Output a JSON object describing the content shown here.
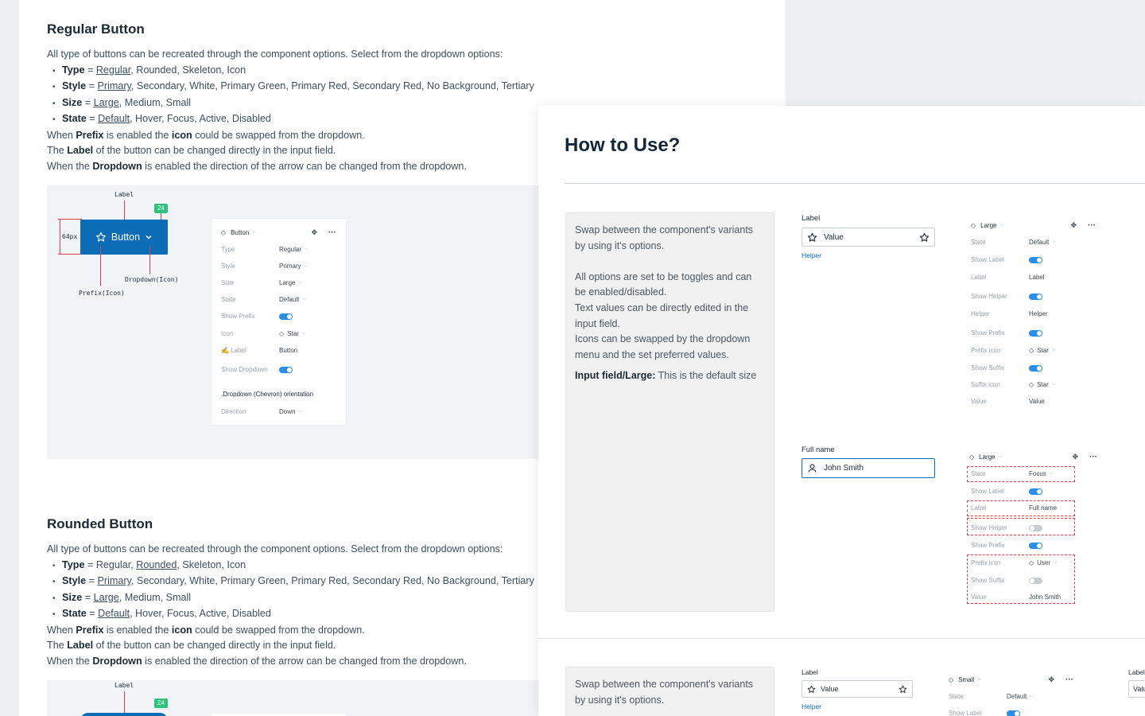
{
  "regular_section": {
    "title": "Regular Button",
    "intro": "All type of buttons can be recreated through the component options. Select from the dropdown options:",
    "type_key": "Type",
    "type_selected": "Regular",
    "type_rest": ", Rounded, Skeleton, Icon",
    "style_key": "Style",
    "style_selected": "Primary",
    "style_rest": ", Secondary, White, Primary Green, Primary Red, Secondary Red, No Background, Tertiary",
    "size_key": "Size",
    "size_selected": "Large",
    "size_rest": ", Medium, Small",
    "state_key": "State",
    "state_selected": "Default",
    "state_rest": ", Hover, Focus, Active, Disabled",
    "prefix_pre": "When ",
    "prefix_key": "Prefix",
    "prefix_mid": " is enabled the ",
    "prefix_icon": "icon",
    "prefix_post": " could be swapped from the dropdown.",
    "label_pre": "The ",
    "label_key": "Label",
    "label_post": " of the button can be changed directly in the input field.",
    "dropdown_pre": "When the ",
    "dropdown_key": "Dropdown",
    "dropdown_post": " is enabled the direction of the arrow can be changed from the dropdown."
  },
  "rounded_section": {
    "title": "Rounded Button",
    "intro": "All type of buttons can be recreated through the component options. Select from the dropdown options:",
    "type_key": "Type",
    "type_pre": " = Regular, ",
    "type_selected": "Rounded",
    "type_rest": ", Skeleton, Icon",
    "style_key": "Style",
    "style_selected": "Primary",
    "style_rest": ", Secondary, White, Primary Green, Primary Red, Secondary Red, No Background, Tertiary",
    "size_key": "Size",
    "size_selected": "Large",
    "size_rest": ", Medium, Small",
    "state_key": "State",
    "state_selected": "Default",
    "state_rest": ", Hover, Focus, Active, Disabled",
    "prefix_pre": "When ",
    "prefix_key": "Prefix",
    "prefix_mid": " is enabled the ",
    "prefix_icon": "icon",
    "prefix_post": " could be swapped from the dropdown.",
    "label_pre": "The ",
    "label_key": "Label",
    "label_post": " of the button can be changed directly in the input field.",
    "dropdown_pre": "When the ",
    "dropdown_key": "Dropdown",
    "dropdown_post": " is enabled the direction of the arrow can be changed from the dropdown."
  },
  "equals": " = ",
  "demo": {
    "label_anno": "Label",
    "badge": "24",
    "height_anno": "64px",
    "button_text": "Button",
    "dropdown_anno": "Dropdown(Icon)",
    "prefix_anno": "Prefix(Icon)"
  },
  "button_panel": {
    "name": "Button",
    "rows": [
      {
        "key": "Type",
        "value": "Regular"
      },
      {
        "key": "Style",
        "value": "Primary"
      },
      {
        "key": "Size",
        "value": "Large"
      },
      {
        "key": "State",
        "value": "Default"
      },
      {
        "key": "Show Prefix"
      },
      {
        "key": "Icon",
        "value": "Star"
      },
      {
        "key": "Label",
        "value": "Button"
      },
      {
        "key": "Show Dropdown"
      }
    ],
    "section_title": ".Dropdown (Chevron) orientation",
    "direction_key": "Direction",
    "direction_value": "Down"
  },
  "how_to_use": {
    "title": "How to Use?",
    "note1_p1": "Swap between the component's variants by using it's options.",
    "note1_p2": "All options are set to be toggles and can be enabled/disabled.",
    "note1_p3": "Text values can be directly edited in the input field.",
    "note1_p4": "Icons can be swapped by the dropdown menu and the set preferred values.",
    "note1_bold": "Input field/Large:",
    "note1_tail": " This is the default size",
    "note2_p1": "Swap between the component's variants by using it's options."
  },
  "input_example_1": {
    "label": "Label",
    "value": "Value",
    "helper": "Helper"
  },
  "panel_1": {
    "size": "Large",
    "rows": [
      {
        "key": "State",
        "value": "Default"
      },
      {
        "key": "Show Label"
      },
      {
        "key": "Label",
        "value": "Label"
      },
      {
        "key": "Show Helper"
      },
      {
        "key": "Helper",
        "value": "Helper"
      },
      {
        "key": "Show Prefix"
      },
      {
        "key": "Prefix icon",
        "value": "Star"
      },
      {
        "key": "Show Suffix"
      },
      {
        "key": "Suffix icon",
        "value": "Star"
      },
      {
        "key": "Value",
        "value": "Value"
      }
    ]
  },
  "input_example_2": {
    "label": "Full name",
    "value": "John Smith"
  },
  "panel_2": {
    "size": "Large",
    "rows": [
      {
        "key": "State",
        "value": "Focus"
      },
      {
        "key": "Show Label"
      },
      {
        "key": "Label",
        "value": "Full name"
      },
      {
        "key": "Show Helper"
      },
      {
        "key": "Show Prefix"
      },
      {
        "key": "Prefix icon",
        "value": "User"
      },
      {
        "key": "Show Suffix"
      },
      {
        "key": "Value",
        "value": "John Smith"
      }
    ]
  },
  "input_example_3": {
    "label": "Label",
    "value": "Value",
    "helper": "Helper"
  },
  "panel_3": {
    "size": "Small",
    "rows": [
      {
        "key": "State",
        "value": "Default"
      },
      {
        "key": "Show Label"
      }
    ]
  },
  "input_example_4": {
    "label": "Label",
    "value": "Valu"
  },
  "colors": {
    "primary": "#0c6cb6",
    "toggle_on": "#2d8ce6",
    "annotation_red": "#e53a4a",
    "badge_green": "#2ec27e"
  }
}
